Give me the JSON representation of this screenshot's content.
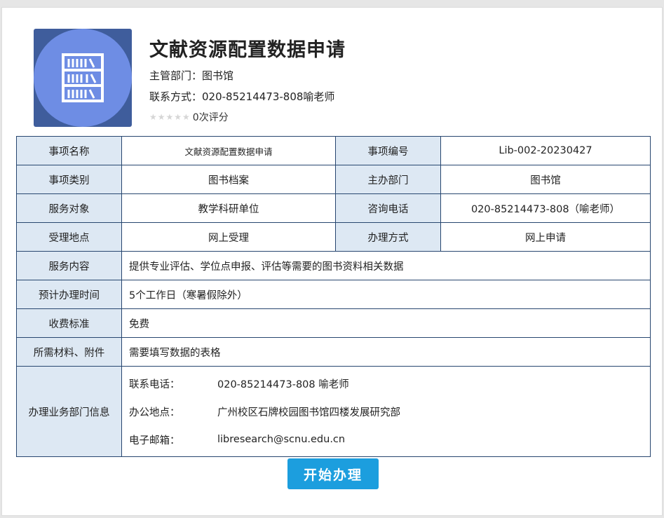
{
  "header": {
    "title": "文献资源配置数据申请",
    "department": "主管部门：图书馆",
    "contact": "联系方式：020-85214473-808喻老师",
    "stars": "★★★★★",
    "rating_text": "0次评分"
  },
  "table": {
    "item_name_label": "事项名称",
    "item_name_value": "文献资源配置数据申请",
    "item_no_label": "事项编号",
    "item_no_value": "Lib-002-20230427",
    "category_label": "事项类别",
    "category_value": "图书档案",
    "host_dept_label": "主办部门",
    "host_dept_value": "图书馆",
    "target_label": "服务对象",
    "target_value": "教学科研单位",
    "phone_label": "咨询电话",
    "phone_value": "020-85214473-808（喻老师）",
    "location_label": "受理地点",
    "location_value": "网上受理",
    "method_label": "办理方式",
    "method_value": "网上申请",
    "content_label": "服务内容",
    "content_value": "提供专业评估、学位点申报、评估等需要的图书资料相关数据",
    "time_label": "预计办理时间",
    "time_value": "5个工作日（寒暑假除外）",
    "fee_label": "收费标准",
    "fee_value": "免费",
    "materials_label": "所需材料、附件",
    "materials_value": "需要填写数据的表格",
    "dept_info_label": "办理业务部门信息",
    "dept_phone_key": "联系电话：",
    "dept_phone_value": "020-85214473-808  喻老师",
    "dept_addr_key": "办公地点：",
    "dept_addr_value": "广州校区石牌校园图书馆四楼发展研究部",
    "dept_email_key": "电子邮箱：",
    "dept_email_value": "libresearch@scnu.edu.cn"
  },
  "actions": {
    "start_label": "开始办理"
  },
  "colors": {
    "label_bg": "#dde8f3",
    "border": "#27466f",
    "button": "#1c9ede",
    "logo_bg": "#3f5d9c",
    "logo_circle": "#6e8de4"
  },
  "icons": {
    "logo": "bookshelf-icon"
  }
}
